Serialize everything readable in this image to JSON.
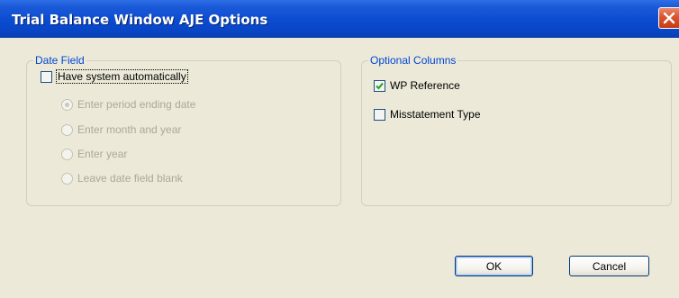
{
  "window": {
    "title": "Trial Balance Window AJE Options"
  },
  "date_field": {
    "caption": "Date Field",
    "auto_checkbox": {
      "label": "Have system automatically",
      "checked": false
    },
    "radios": [
      {
        "label": "Enter period ending date",
        "selected": true,
        "enabled": false
      },
      {
        "label": "Enter month and year",
        "selected": false,
        "enabled": false
      },
      {
        "label": "Enter year",
        "selected": false,
        "enabled": false
      },
      {
        "label": "Leave date field blank",
        "selected": false,
        "enabled": false
      }
    ]
  },
  "optional_columns": {
    "caption": "Optional Columns",
    "items": [
      {
        "label": "WP Reference",
        "checked": true
      },
      {
        "label": "Misstatement Type",
        "checked": false
      }
    ]
  },
  "buttons": {
    "ok": "OK",
    "cancel": "Cancel"
  },
  "colors": {
    "title_bar": "#0A4BD0",
    "dialog_bg": "#ECE9D8",
    "group_caption": "#0046D5",
    "check_mark": "#21A121",
    "disabled_text": "#ACA899",
    "close_button": "#D9532D"
  },
  "icons": {
    "close": "close-icon",
    "check": "check-icon"
  }
}
